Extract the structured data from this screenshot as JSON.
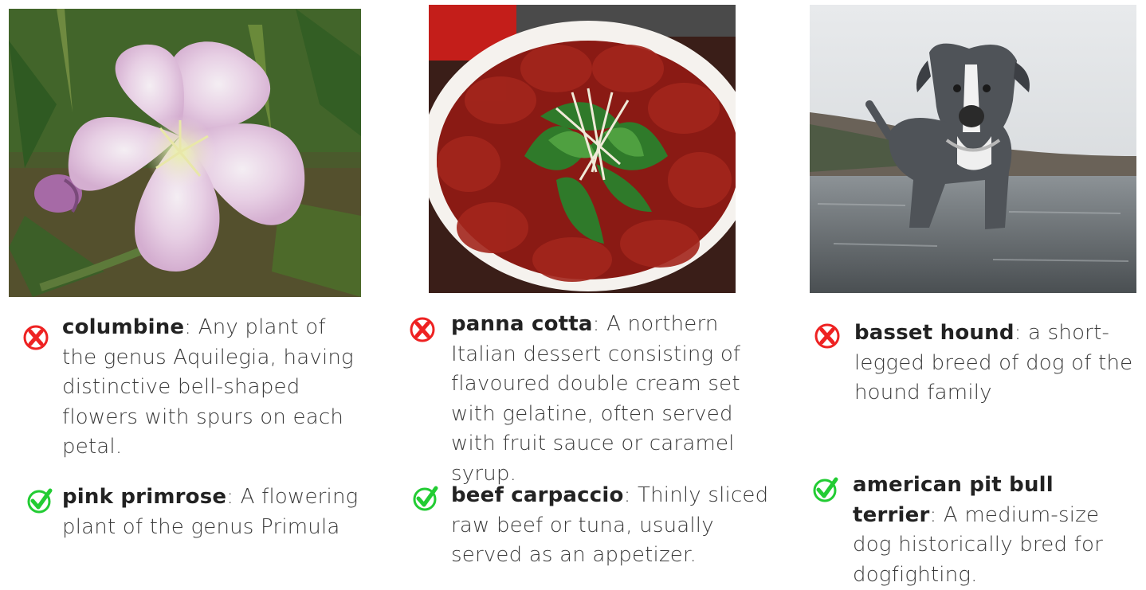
{
  "colors": {
    "wrong": "#ee2222",
    "correct": "#22cc33"
  },
  "panels": [
    {
      "image_subject": "pink flower on green foliage",
      "wrong": {
        "icon": "x-circle-icon",
        "term": "columbine",
        "definition": " Any plant of the genus Aquilegia, having distinctive bell-shaped flowers with spurs on each petal."
      },
      "correct": {
        "icon": "check-circle-icon",
        "term": "pink primrose",
        "definition": " A flowering plant of the genus Primula"
      }
    },
    {
      "image_subject": "plate of thinly sliced red meat topped with greens",
      "wrong": {
        "icon": "x-circle-icon",
        "term": "panna cotta",
        "definition": " A northern Italian dessert consisting of flavoured double cream set with gelatine, often served with fruit sauce or caramel syrup."
      },
      "correct": {
        "icon": "check-circle-icon",
        "term": "beef carpaccio",
        "definition": " Thinly sliced raw beef or tuna, usually served as an appetizer."
      }
    },
    {
      "image_subject": "grey dog standing in shallow water",
      "wrong": {
        "icon": "x-circle-icon",
        "term": "basset hound",
        "definition": " a short-legged breed of dog of the hound family"
      },
      "correct": {
        "icon": "check-circle-icon",
        "term": "american pit bull terrier",
        "definition": " A medium-size dog historically bred for dogfighting."
      }
    }
  ]
}
